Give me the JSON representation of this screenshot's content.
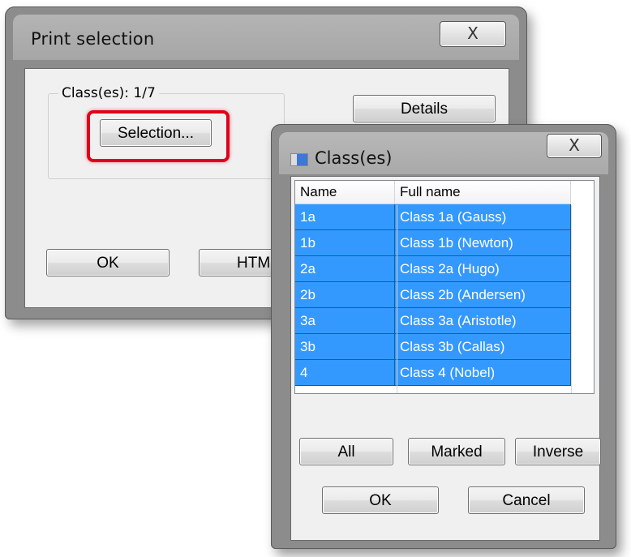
{
  "print_dialog": {
    "title": "Print selection",
    "close_glyph": "X",
    "group_label": "Class(es): 1/7",
    "selection_button": "Selection...",
    "details_button": "Details",
    "ok_button": "OK",
    "html_button": "HTML",
    "highlight_color": "#e0001b"
  },
  "classes_dialog": {
    "title": "Class(es)",
    "close_glyph": "X",
    "columns": [
      "Name",
      "Full name"
    ],
    "rows": [
      {
        "name": "1a",
        "full_name": "Class 1a (Gauss)"
      },
      {
        "name": "1b",
        "full_name": "Class 1b (Newton)"
      },
      {
        "name": "2a",
        "full_name": "Class 2a (Hugo)"
      },
      {
        "name": "2b",
        "full_name": "Class 2b (Andersen)"
      },
      {
        "name": "3a",
        "full_name": "Class 3a (Aristotle)"
      },
      {
        "name": "3b",
        "full_name": "Class 3b (Callas)"
      },
      {
        "name": "4",
        "full_name": "Class 4 (Nobel)"
      }
    ],
    "selection_color": "#3399ff",
    "all_button": "All",
    "marked_button": "Marked",
    "inverse_button": "Inverse",
    "ok_button": "OK",
    "cancel_button": "Cancel"
  }
}
